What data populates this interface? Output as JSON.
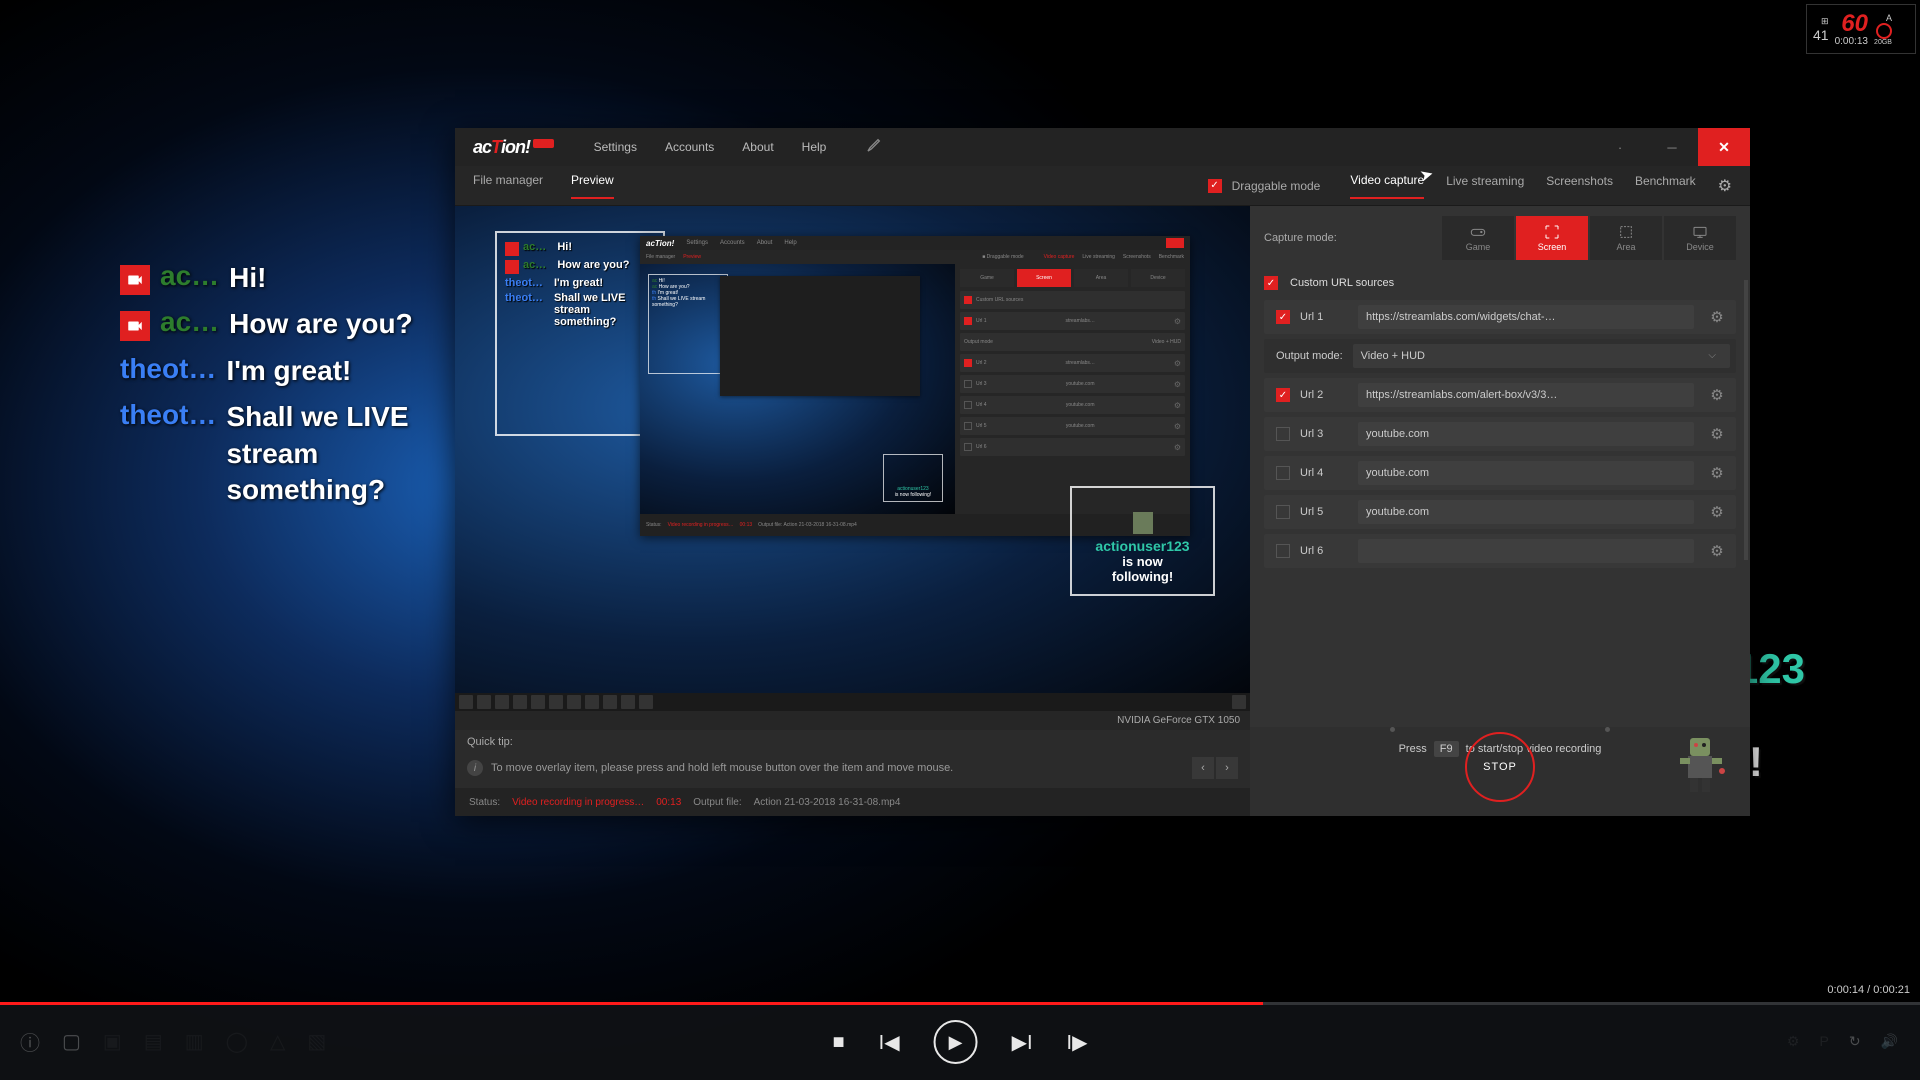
{
  "fps_overlay": {
    "fps": "60",
    "fps_small": "41",
    "timer": "0:00:13",
    "bitrate": "20GB",
    "mode": "A"
  },
  "chat": [
    {
      "icon": true,
      "user": "ac…",
      "userClass": "a",
      "msg": "Hi!"
    },
    {
      "icon": true,
      "user": "ac…",
      "userClass": "a",
      "msg": "How are you?"
    },
    {
      "icon": false,
      "user": "theot…",
      "userClass": "b",
      "msg": "I'm great!"
    },
    {
      "icon": false,
      "user": "theot…",
      "userClass": "b",
      "msg": "Shall we LIVE stream something?"
    }
  ],
  "follow_alert": {
    "user": "actionuser123",
    "line1": "is now",
    "line2": "following!"
  },
  "app": {
    "logo_pre": "ac",
    "logo_mid": "T",
    "logo_post": "ion!",
    "beta": "BETA",
    "menu": [
      "Settings",
      "Accounts",
      "About",
      "Help"
    ],
    "file_tabs": {
      "file_manager": "File manager",
      "preview": "Preview"
    },
    "draggable": {
      "label": "Draggable mode",
      "checked": true
    },
    "side_tabs": [
      "Video capture",
      "Live streaming",
      "Screenshots",
      "Benchmark"
    ],
    "capture_mode_label": "Capture mode:",
    "modes": [
      "Game",
      "Screen",
      "Area",
      "Device"
    ],
    "custom_url_label": "Custom URL sources",
    "urls": {
      "url1": {
        "label": "Url 1",
        "checked": true,
        "value": "https://streamlabs.com/widgets/chat-…"
      },
      "output_mode": {
        "label": "Output mode:",
        "value": "Video + HUD"
      },
      "url2": {
        "label": "Url 2",
        "checked": true,
        "value": "https://streamlabs.com/alert-box/v3/3…"
      },
      "url3": {
        "label": "Url 3",
        "checked": false,
        "value": "youtube.com"
      },
      "url4": {
        "label": "Url 4",
        "checked": false,
        "value": "youtube.com"
      },
      "url5": {
        "label": "Url 5",
        "checked": false,
        "value": "youtube.com"
      },
      "url6": {
        "label": "Url 6",
        "checked": false,
        "value": ""
      }
    },
    "press_text_pre": "Press",
    "press_key": "F9",
    "press_text_post": "to start/stop video recording",
    "stop_label": "STOP",
    "mini_chat": [
      {
        "icon": true,
        "user": "ac…",
        "cls": "a",
        "msg": "Hi!"
      },
      {
        "icon": true,
        "user": "ac…",
        "cls": "a",
        "msg": "How are you?"
      },
      {
        "icon": false,
        "user": "theot…",
        "cls": "b",
        "msg": "I'm great!"
      },
      {
        "icon": false,
        "user": "theot…",
        "cls": "b",
        "msg": "Shall we LIVE stream something?"
      }
    ],
    "mini_follow": {
      "user": "actionuser123",
      "line1": "is now",
      "line2": "following!"
    },
    "gpu": "NVIDIA GeForce GTX 1050",
    "tip_label": "Quick tip:",
    "tip_text": "To move overlay item, please press and hold left mouse button over the item and move mouse.",
    "status": {
      "label": "Status:",
      "text": "Video recording in progress…",
      "time": "00:13",
      "output_label": "Output file:",
      "output_file": "Action 21-03-2018 16-31-08.mp4"
    }
  },
  "player": {
    "time": "0:00:14 / 0:00:21"
  }
}
